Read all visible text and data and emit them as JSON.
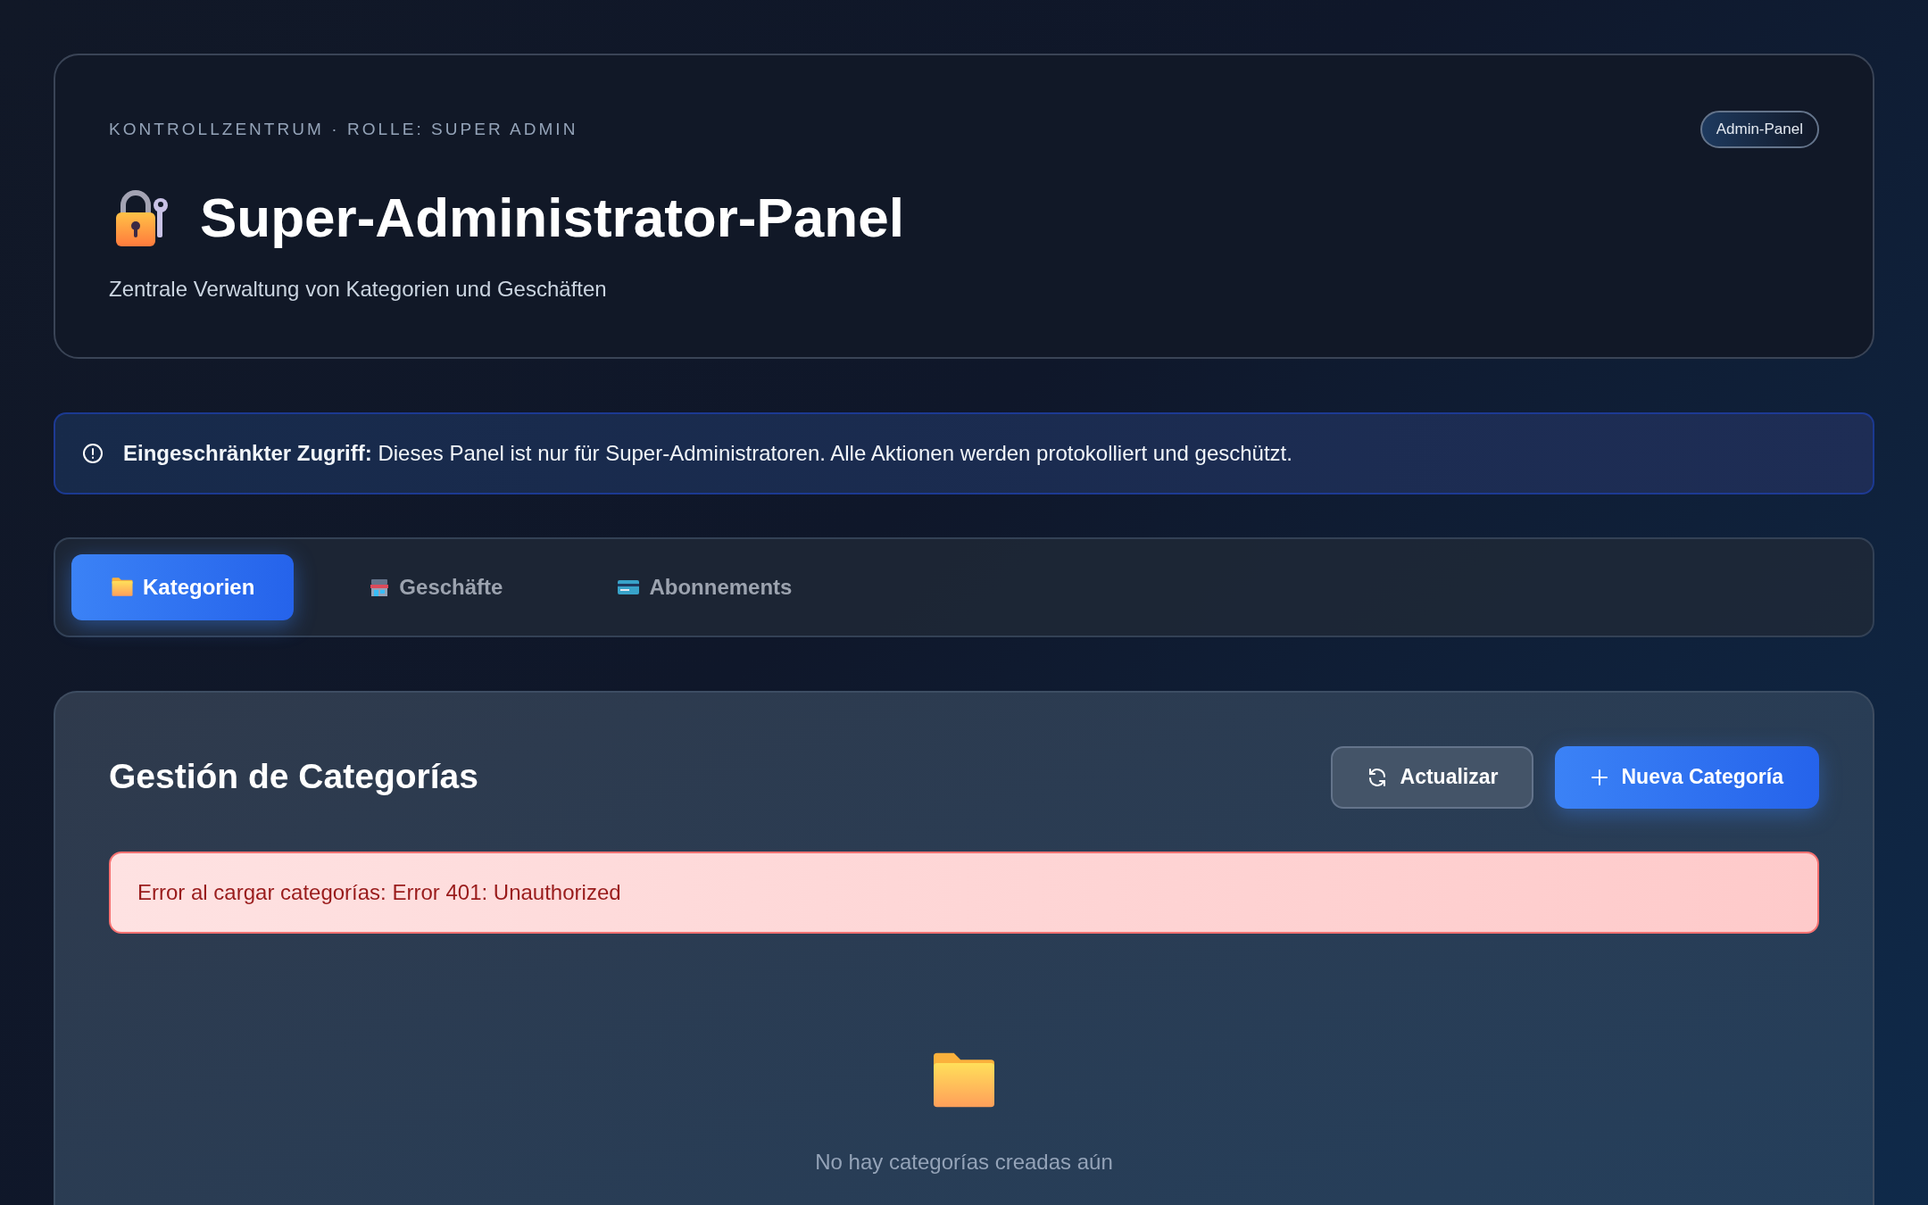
{
  "header": {
    "eyebrow": "KONTROLLZENTRUM · ROLLE: SUPER ADMIN",
    "badge": "Admin-Panel",
    "title": "Super-Administrator-Panel",
    "subtitle": "Zentrale Verwaltung von Kategorien und Geschäften"
  },
  "notice": {
    "text": "**Eingeschränkter Zugriff:** Dieses Panel ist nur für Super-Administratoren. Alle Aktionen werden protokolliert und geschützt."
  },
  "tabs": [
    {
      "label": "Kategorien",
      "kind": "folder",
      "selected": true
    },
    {
      "label": "Geschäfte",
      "kind": "store",
      "selected": false
    },
    {
      "label": "Abonnements",
      "kind": "card",
      "selected": false
    }
  ],
  "section": {
    "title": "Gestión de Categorías",
    "buttons": [
      {
        "label": "Actualizar",
        "kind": "refresh"
      },
      {
        "label": "Nueva Categoría",
        "kind": "add"
      }
    ],
    "error": "Error al cargar categorías: Error 401: Unauthorized",
    "empty_text": "No hay categorías creadas aún"
  }
}
